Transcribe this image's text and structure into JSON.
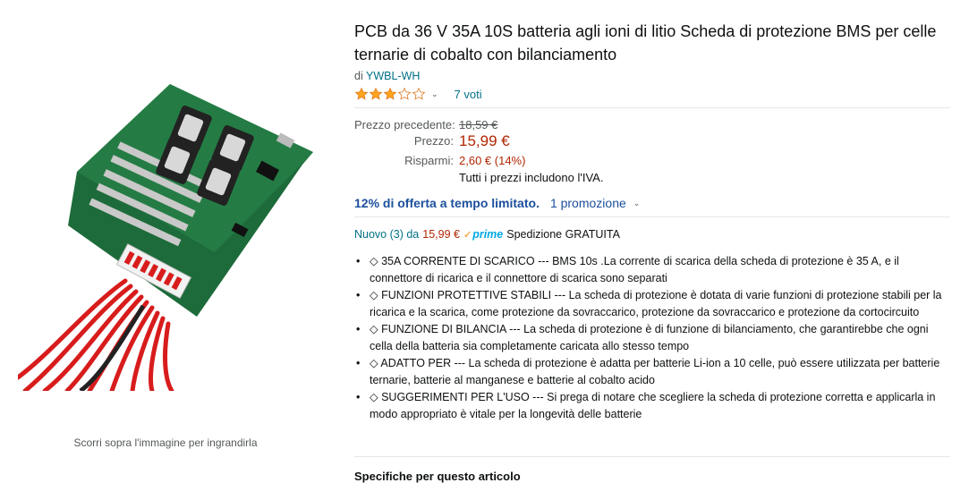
{
  "gallery": {
    "zoom_hint": "Scorri sopra l'immagine per ingrandirla"
  },
  "product": {
    "title": "PCB da 36 V 35A 10S batteria agli ioni di litio Scheda di protezione BMS per celle ternarie di cobalto con bilanciamento",
    "by_prefix": "di",
    "brand": "YWBL-WH",
    "rating_stars": 3,
    "rating_max": 5,
    "rating_count_label": "7 voti"
  },
  "price": {
    "previous_label": "Prezzo precedente:",
    "previous_value": "18,59 €",
    "price_label": "Prezzo:",
    "price_value": "15,99 €",
    "savings_label": "Risparmi:",
    "savings_value": "2,60 € (14%)",
    "vat_note": "Tutti i prezzi includono l'IVA."
  },
  "offer": {
    "deal_text": "12% di offerta a tempo limitato.",
    "promo_text": "1 promozione"
  },
  "new_offers": {
    "link_text": "Nuovo (3) da",
    "price": "15,99 €",
    "prime_label": "prime",
    "shipping": "Spedizione GRATUITA"
  },
  "bullets": [
    "◇ 35A CORRENTE DI SCARICO --- BMS 10s .La corrente di scarica della scheda di protezione è 35 A, e il connettore di ricarica e il connettore di scarica sono separati",
    "◇ FUNZIONI PROTETTIVE STABILI --- La scheda di protezione è dotata di varie funzioni di protezione stabili per la ricarica e la scarica, come protezione da sovraccarico, protezione da sovraccarico e protezione da cortocircuito",
    "◇ FUNZIONE DI BILANCIA --- La scheda di protezione è di funzione di bilanciamento, che garantirebbe che ogni cella della batteria sia completamente caricata allo stesso tempo",
    "◇ ADATTO PER --- La scheda di protezione è adatta per batterie Li-ion a 10 celle, può essere utilizzata per batterie ternarie, batterie al manganese e batterie al cobalto acido",
    "◇ SUGGERIMENTI PER L'USO --- Si prega di notare che scegliere la scheda di protezione corretta e applicarla in modo appropriato è vitale per la longevità delle batterie"
  ],
  "specs_heading": "Specifiche per questo articolo",
  "colors": {
    "link": "#007185",
    "price_red": "#b12704",
    "star": "#ffa41c",
    "deal_blue": "#1c4f9c"
  }
}
